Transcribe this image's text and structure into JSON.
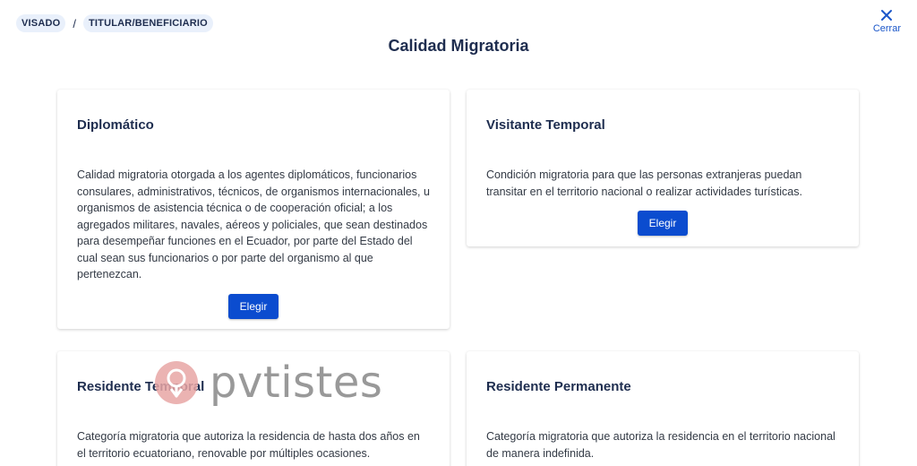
{
  "breadcrumb": {
    "items": [
      "VISADO",
      "TITULAR/BENEFICIARIO"
    ],
    "separator": "/"
  },
  "close": {
    "label": "Cerrar",
    "icon": "close-icon"
  },
  "title": "Calidad Migratoria",
  "cards": [
    {
      "title": "Diplomático",
      "description": "Calidad migratoria otorgada a los agentes diplomáticos, funcionarios consulares, administrativos, técnicos, de organismos internacionales, u organismos de asistencia técnica o de cooperación oficial; a los agregados militares, navales, aéreos y policiales, que sean destinados para desempeñar funciones en el Ecuador, por parte del Estado del cual sean sus funcionarios o por parte del organismo al que pertenezcan.",
      "button": "Elegir"
    },
    {
      "title": "Visitante Temporal",
      "description": "Condición migratoria para que las personas extranjeras puedan transitar en el territorio nacional o realizar actividades turísticas.",
      "button": "Elegir"
    },
    {
      "title": "Residente Temporal",
      "description": "Categoría migratoria que autoriza la residencia de hasta dos años en el territorio ecuatoriano, renovable por múltiples ocasiones."
    },
    {
      "title": "Residente Permanente",
      "description": "Categoría migratoria que autoriza la residencia en el territorio nacional de manera indefinida."
    }
  ],
  "watermark": {
    "text": "pvtistes"
  },
  "colors": {
    "primary": "#0b4ccf",
    "title": "#1e2d4f",
    "chip_bg": "#e9f0fb",
    "watermark_logo": "#e8a6a4"
  }
}
